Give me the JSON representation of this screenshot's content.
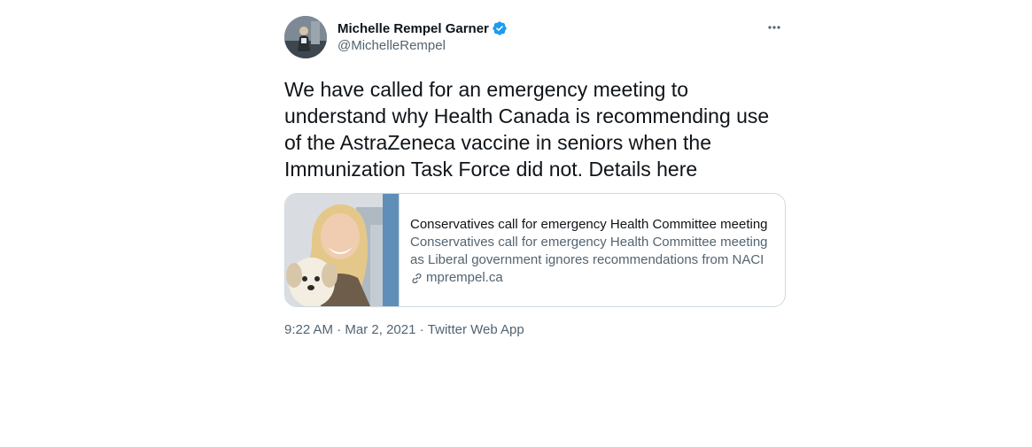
{
  "author": {
    "display_name": "Michelle Rempel Garner",
    "handle": "@MichelleRempel",
    "verified": true,
    "verified_color": "#1d9bf0"
  },
  "icons": {
    "more": "more-options-icon",
    "verified": "verified-badge-icon",
    "link": "link-icon"
  },
  "tweet": {
    "text": "We have called for an emergency meeting to understand why Health Canada is recommending use of the AstraZeneca vaccine in seniors when the Immunization Task Force did not. Details here"
  },
  "card": {
    "title": "Conservatives call for emergency Health Committee meeting",
    "description": "Conservatives call for emergency Health Committee meeting as Liberal government ignores recommendations from NACI",
    "domain": "mprempel.ca"
  },
  "meta": {
    "time": "9:22 AM",
    "separator": " · ",
    "date": "Mar 2, 2021",
    "source": "Twitter Web App"
  }
}
